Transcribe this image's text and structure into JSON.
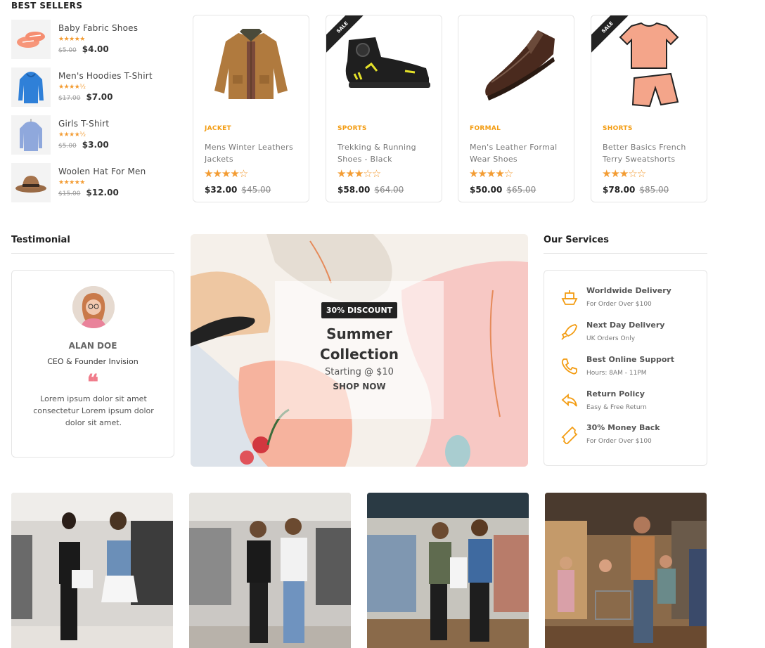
{
  "best_sellers": {
    "title": "BEST SELLERS",
    "items": [
      {
        "name": "Baby Fabric Shoes",
        "stars": "★★★★★",
        "old_price": "$5.00",
        "new_price": "$4.00"
      },
      {
        "name": "Men's Hoodies T-Shirt",
        "stars": "★★★★½",
        "old_price": "$17.00",
        "new_price": "$7.00"
      },
      {
        "name": "Girls T-Shirt",
        "stars": "★★★★½",
        "old_price": "$5.00",
        "new_price": "$3.00"
      },
      {
        "name": "Woolen Hat For Men",
        "stars": "★★★★★",
        "old_price": "$15.00",
        "new_price": "$12.00"
      }
    ]
  },
  "products": [
    {
      "category": "JACKET",
      "name": "Mens Winter Leathers Jackets",
      "rating": 4,
      "stars": "★★★★☆",
      "price": "$32.00",
      "old_price": "$45.00",
      "sale": false,
      "sale_label": ""
    },
    {
      "category": "SPORTS",
      "name": "Trekking & Running Shoes - Black",
      "rating": 3,
      "stars": "★★★☆☆",
      "price": "$58.00",
      "old_price": "$64.00",
      "sale": true,
      "sale_label": "SALE"
    },
    {
      "category": "FORMAL",
      "name": "Men's Leather Formal Wear Shoes",
      "rating": 4,
      "stars": "★★★★☆",
      "price": "$50.00",
      "old_price": "$65.00",
      "sale": false,
      "sale_label": ""
    },
    {
      "category": "SHORTS",
      "name": "Better Basics French Terry Sweatshorts",
      "rating": 3,
      "stars": "★★★☆☆",
      "price": "$78.00",
      "old_price": "$85.00",
      "sale": true,
      "sale_label": "SALE"
    }
  ],
  "testimonial": {
    "title": "Testimonial",
    "name": "ALAN DOE",
    "role": "CEO & Founder Invision",
    "quote_mark": "❝",
    "text": "Lorem ipsum dolor sit amet consectetur Lorem ipsum dolor dolor sit amet."
  },
  "banner": {
    "discount": "30% DISCOUNT",
    "title": "Summer Collection",
    "subtitle": "Starting @ $10",
    "cta": "SHOP NOW"
  },
  "services": {
    "title": "Our Services",
    "items": [
      {
        "name": "Worldwide Delivery",
        "desc": "For Order Over $100",
        "icon": "ship-icon"
      },
      {
        "name": "Next Day Delivery",
        "desc": "UK Orders Only",
        "icon": "rocket-icon"
      },
      {
        "name": "Best Online Support",
        "desc": "Hours: 8AM - 11PM",
        "icon": "phone-icon"
      },
      {
        "name": "Return Policy",
        "desc": "Easy & Free Return",
        "icon": "return-arrow-icon"
      },
      {
        "name": "30% Money Back",
        "desc": "For Order Over $100",
        "icon": "ticket-icon"
      }
    ]
  },
  "colors": {
    "accent": "#f39c12",
    "star": "#f39c33",
    "quote": "#f07c8b",
    "dark": "#222222"
  }
}
